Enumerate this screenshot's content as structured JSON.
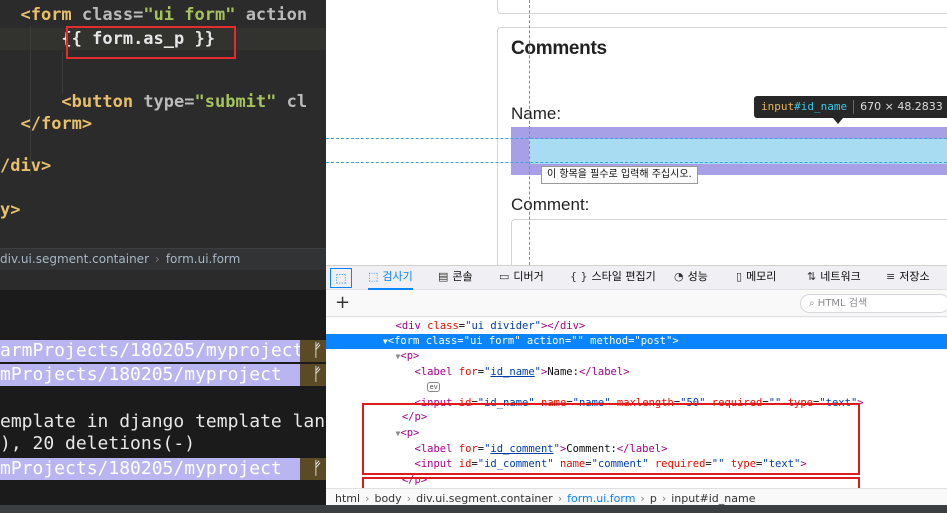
{
  "editor": {
    "lines": [
      {
        "indent": "  ",
        "tag_open": "<form",
        "attr": " class=",
        "val": "\"ui form\"",
        "rest": " action"
      },
      {
        "indent": "      ",
        "text": "{{ form.as_p }}"
      },
      {
        "indent": "",
        "text": ""
      },
      {
        "indent": "",
        "text": ""
      },
      {
        "indent": "      ",
        "tag_open": "<button",
        "attr": " type=",
        "val": "\"submit\"",
        "rest": " cl"
      },
      {
        "indent": "  ",
        "tag_open": "</form>",
        "attr": "",
        "val": "",
        "rest": ""
      },
      {
        "indent": "",
        "text": ""
      },
      {
        "indent": "",
        "tag_open": "/div>",
        "attr": "",
        "val": "",
        "rest": ""
      },
      {
        "indent": "",
        "text": ""
      },
      {
        "indent": "",
        "tag_open": "y>",
        "attr": "",
        "val": "",
        "rest": ""
      }
    ],
    "breadcrumb": [
      "div.ui.segment.container",
      "form.ui.form"
    ],
    "breadcrumb_sep": "›"
  },
  "terminal": {
    "lines": [
      {
        "kind": "path",
        "text": "armProjects/180205/myproject"
      },
      {
        "kind": "path",
        "text": "mProjects/180205/myproject"
      },
      {
        "kind": "blank",
        "text": ""
      },
      {
        "kind": "text",
        "text": "emplate in django template lang"
      },
      {
        "kind": "text",
        "text": "), 20 deletions(-)"
      },
      {
        "kind": "path",
        "text": "mProjects/180205/myproject"
      }
    ],
    "branch_glyph": "ᚠ"
  },
  "page": {
    "section_title": "Comments",
    "name_label": "Name:",
    "comment_label": "Comment:",
    "validation_message": "이 항목을 필수로 입력해 주십시오."
  },
  "tooltip": {
    "tag": "input",
    "id": "#id_name",
    "size": "670 × 48.2833"
  },
  "devtools": {
    "tabs": [
      {
        "icon": "⬚",
        "label": "검사기",
        "active": true
      },
      {
        "icon": "▤",
        "label": "콘솔",
        "active": false
      },
      {
        "icon": "▭",
        "label": "디버거",
        "active": false
      },
      {
        "icon": "{ }",
        "label": "스타일 편집기",
        "active": false
      },
      {
        "icon": "◔",
        "label": "성능",
        "active": false
      },
      {
        "icon": "▯",
        "label": "메모리",
        "active": false
      },
      {
        "icon": "⇅",
        "label": "네트워크",
        "active": false
      },
      {
        "icon": "≡",
        "label": "저장소",
        "active": false
      }
    ],
    "picker_icon": "⬚",
    "add_icon": "+",
    "search_placeholder": "HTML 검색",
    "search_icon": "⌕",
    "tree": {
      "divider": {
        "tag": "div",
        "class": "ui divider"
      },
      "form": {
        "tag": "form",
        "class": "ui form",
        "action": "",
        "method": "post"
      },
      "p1": {
        "label_for": "id_name",
        "label_text": "Name:",
        "event_badge": "ev",
        "input": {
          "id": "id_name",
          "name": "name",
          "maxlength": "50",
          "required": "",
          "type": "text"
        }
      },
      "p2": {
        "label_for": "id_comment",
        "label_text": "Comment:",
        "input": {
          "id": "id_comment",
          "name": "comment",
          "required": "",
          "type": "text"
        }
      }
    },
    "breadcrumbs": [
      "html",
      "body",
      "div.ui.segment.container",
      "form.ui.form",
      "p",
      "input#id_name"
    ]
  }
}
